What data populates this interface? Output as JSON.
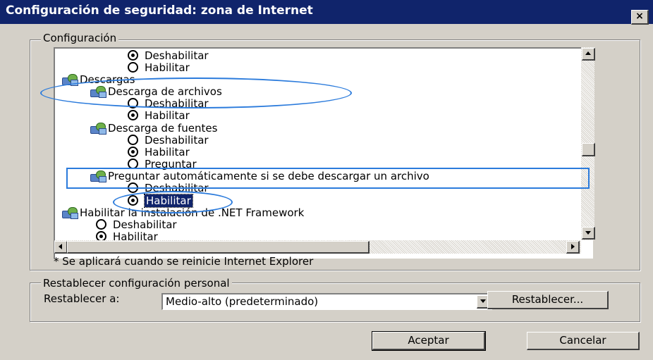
{
  "window": {
    "title": "Configuración de seguridad: zona de Internet",
    "close_label": "×"
  },
  "settings_group": {
    "legend": "Configuración",
    "tree": [
      {
        "kind": "radio",
        "label": "Deshabilitar",
        "checked": true
      },
      {
        "kind": "radio",
        "label": "Habilitar",
        "checked": false
      },
      {
        "kind": "category",
        "label": "Descargas"
      },
      {
        "kind": "setting",
        "label": "Descarga de archivos"
      },
      {
        "kind": "radio",
        "label": "Deshabilitar",
        "checked": false
      },
      {
        "kind": "radio",
        "label": "Habilitar",
        "checked": true
      },
      {
        "kind": "setting",
        "label": "Descarga de fuentes"
      },
      {
        "kind": "radio",
        "label": "Deshabilitar",
        "checked": false
      },
      {
        "kind": "radio",
        "label": "Habilitar",
        "checked": true
      },
      {
        "kind": "radio",
        "label": "Preguntar",
        "checked": false
      },
      {
        "kind": "setting",
        "label": "Preguntar automáticamente si se debe descargar un archivo"
      },
      {
        "kind": "radio",
        "label": "Deshabilitar",
        "checked": false
      },
      {
        "kind": "radio",
        "label": "Habilitar",
        "checked": true,
        "selected": true
      },
      {
        "kind": "category",
        "label": "Habilitar la instalación de .NET Framework"
      },
      {
        "kind": "radio",
        "label": "Deshabilitar",
        "checked": false
      },
      {
        "kind": "radio",
        "label": "Habilitar",
        "checked": true
      }
    ],
    "note": "* Se aplicará cuando se reinicie Internet Explorer"
  },
  "reset_group": {
    "legend": "Restablecer configuración personal",
    "label": "Restablecer a:",
    "selected_level": "Medio-alto (predeterminado)",
    "reset_button": "Restablecer..."
  },
  "buttons": {
    "accept": "Aceptar",
    "cancel": "Cancelar"
  },
  "colors": {
    "titlebar": "#10246b",
    "annotation": "#2b7bdc",
    "dialog": "#d4d0c8"
  }
}
